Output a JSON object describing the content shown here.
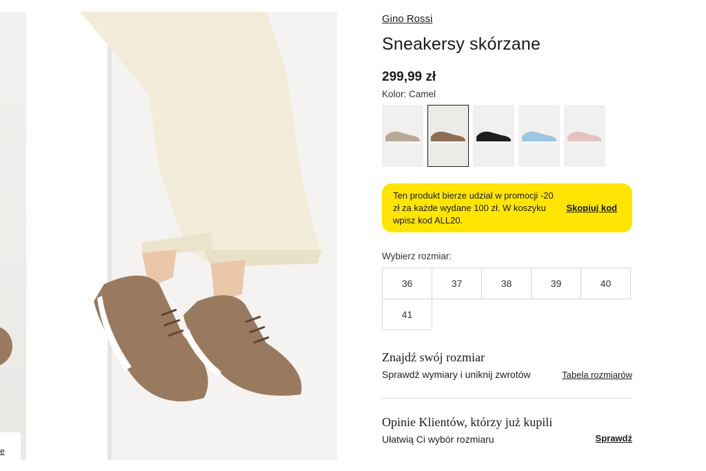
{
  "gallery": {
    "prev_thumb_label": "e",
    "colors": {
      "background": "#f4f3f1",
      "trousers": "#f3ecd9",
      "shoe": "#9a7a5e",
      "skin": "#e9c7a8"
    }
  },
  "product": {
    "brand": "Gino Rossi",
    "title": "Sneakersy skórzane",
    "price": "299,99 zł",
    "color_label": "Kolor: Camel"
  },
  "swatches": [
    {
      "name": "beige",
      "color": "#b9a898",
      "selected": false
    },
    {
      "name": "camel",
      "color": "#8f6d50",
      "selected": true
    },
    {
      "name": "black",
      "color": "#1e1e1e",
      "selected": false
    },
    {
      "name": "light-blue",
      "color": "#9cc6e0",
      "selected": false
    },
    {
      "name": "pink",
      "color": "#e3c3c1",
      "selected": false
    }
  ],
  "promo": {
    "text": "Ten produkt bierze udział w promocji -20 zł za każde wydane 100 zł. W koszyku wpisz kod ALL20.",
    "link": "Skopiuj kod",
    "color": "#ffe500"
  },
  "sizes": {
    "label": "Wybierz rozmiar:",
    "options": [
      "36",
      "37",
      "38",
      "39",
      "40",
      "41"
    ]
  },
  "size_guide": {
    "title": "Znajdź swój rozmiar",
    "subtitle": "Sprawdź wymiary i uniknij zwrotów",
    "link": "Tabela rozmiarów"
  },
  "reviews": {
    "title": "Opinie Klientów, którzy już kupili",
    "subtitle": "Ułatwią Ci wybór rozmiaru",
    "link": "Sprawdź"
  }
}
